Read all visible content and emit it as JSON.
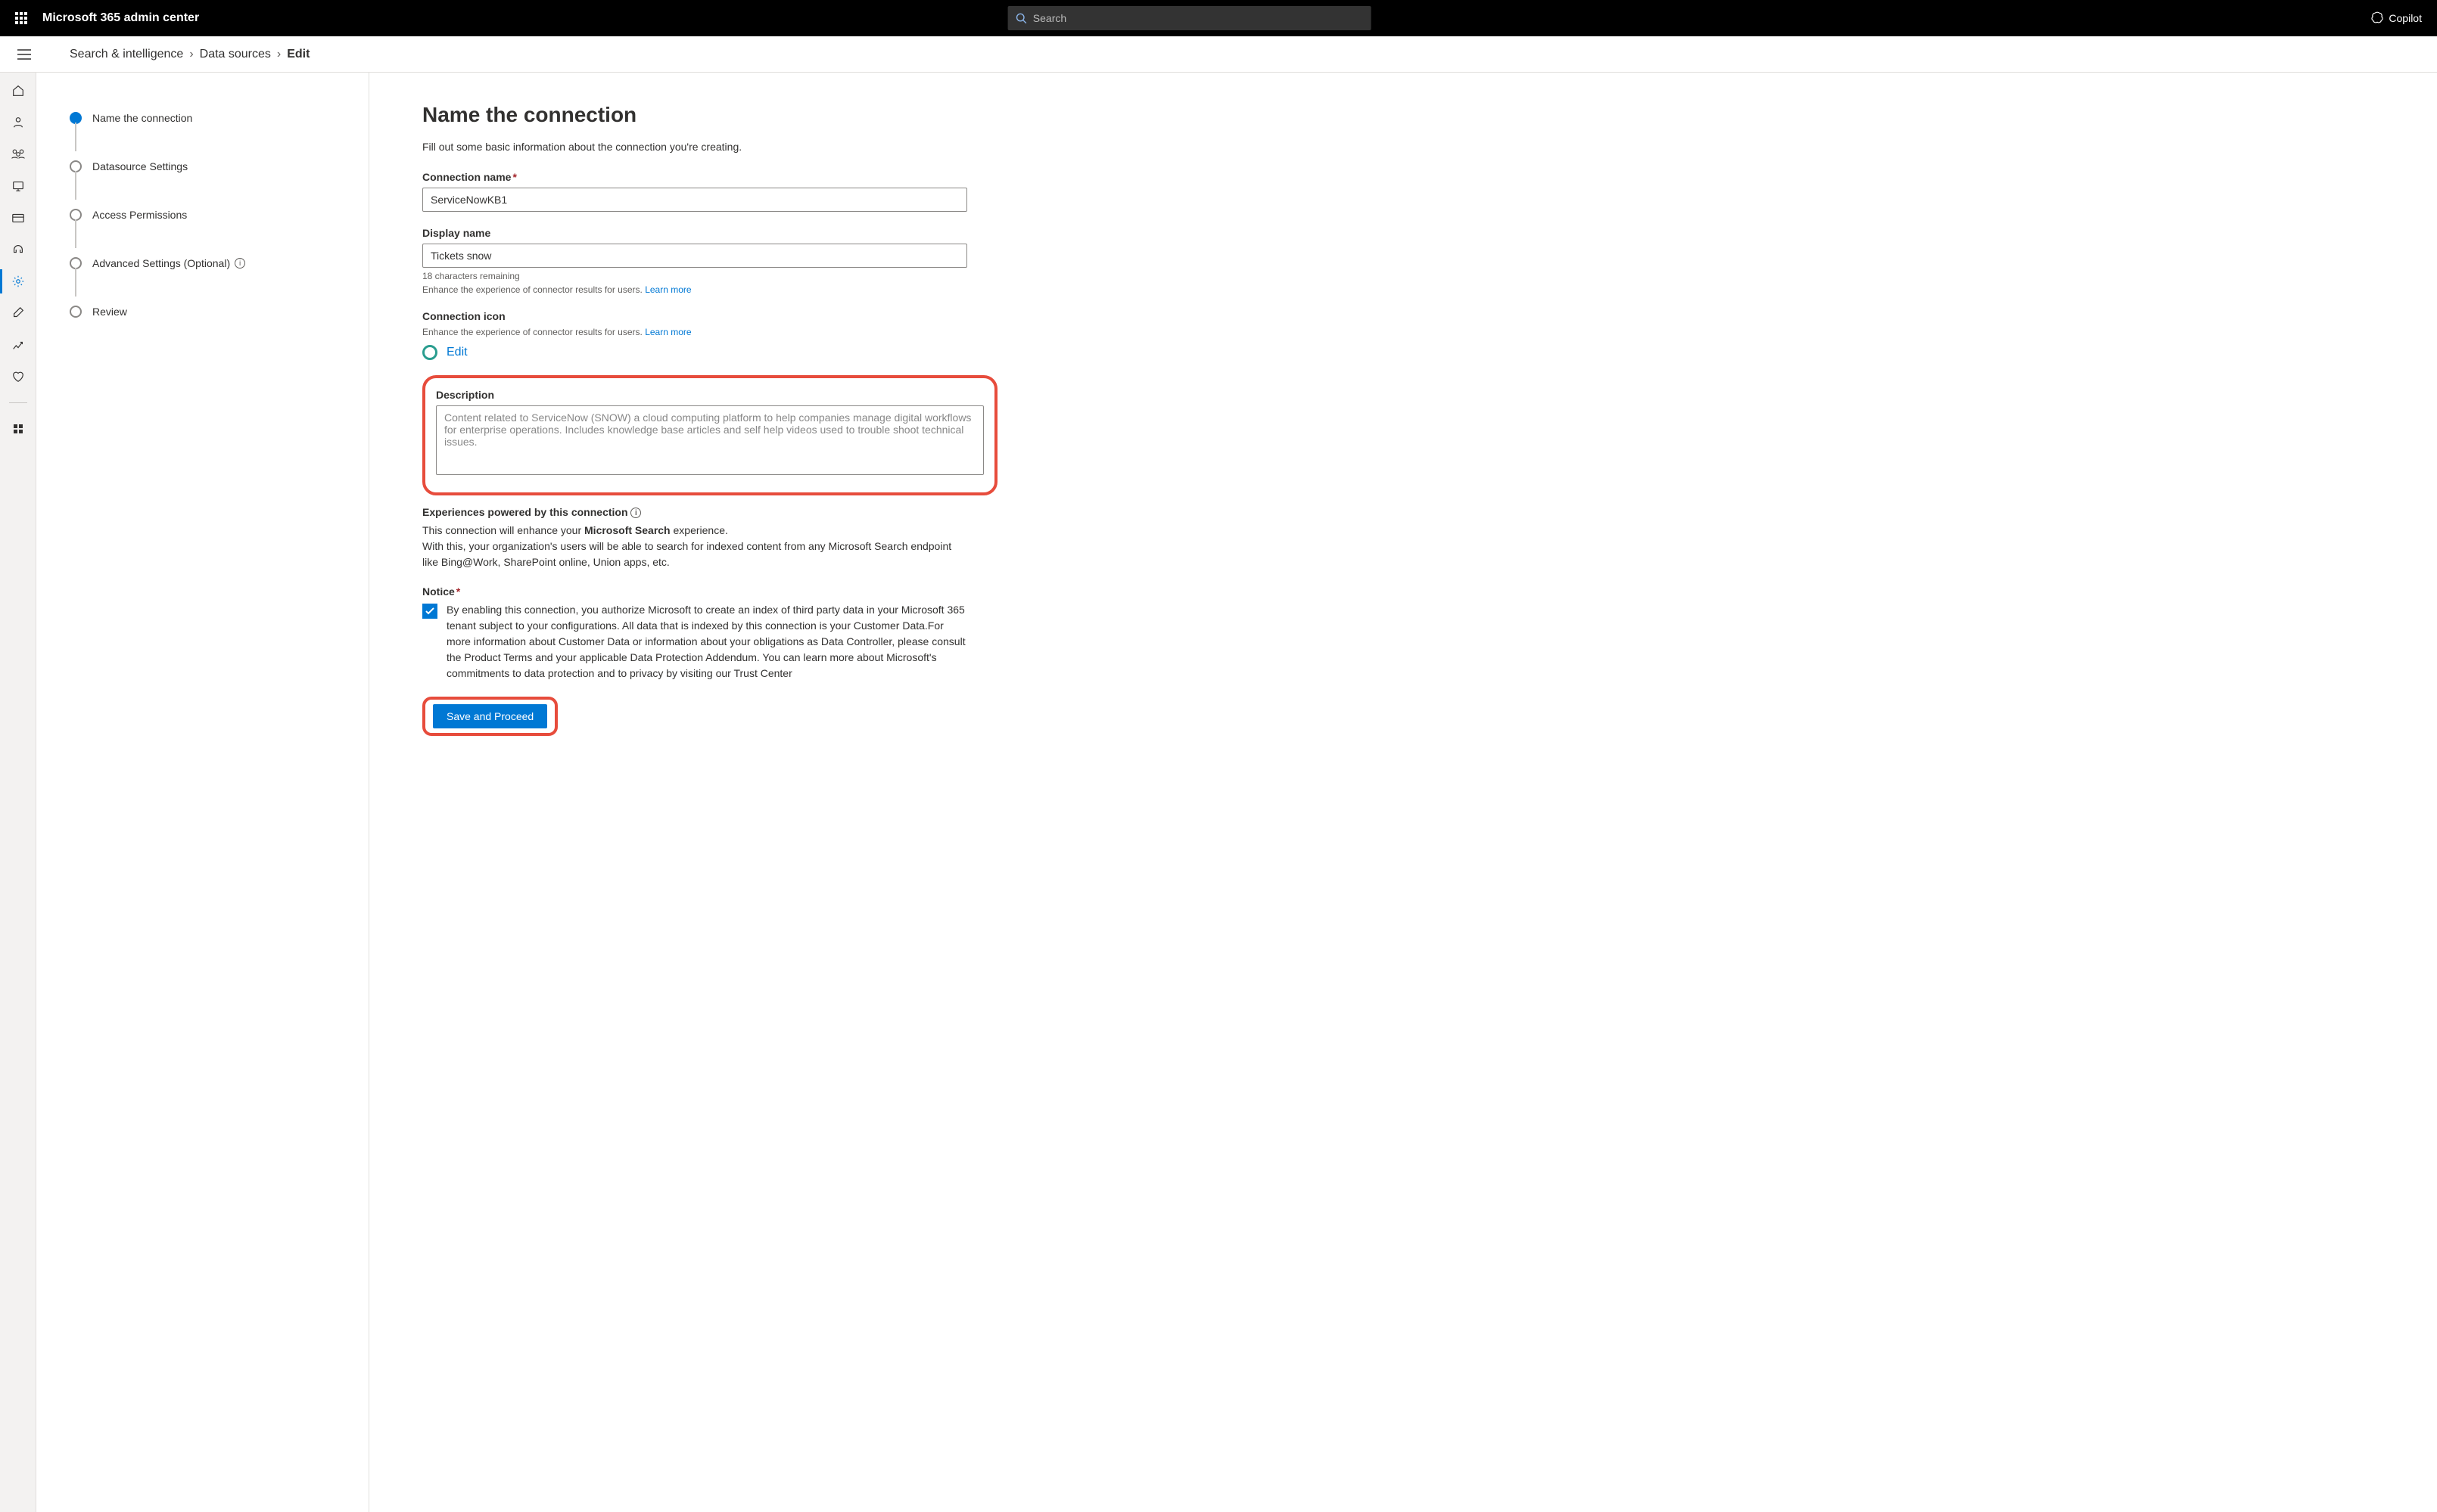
{
  "header": {
    "app_title": "Microsoft 365 admin center",
    "search_placeholder": "Search",
    "copilot_label": "Copilot"
  },
  "breadcrumb": {
    "level1": "Search & intelligence",
    "level2": "Data sources",
    "level3": "Edit"
  },
  "wizard": {
    "steps": [
      {
        "label": "Name the connection",
        "current": true
      },
      {
        "label": "Datasource Settings"
      },
      {
        "label": "Access Permissions"
      },
      {
        "label": "Advanced Settings (Optional)",
        "info": true
      },
      {
        "label": "Review"
      }
    ]
  },
  "page": {
    "title": "Name the connection",
    "intro": "Fill out some basic information about the connection you're creating.",
    "connection_name_label": "Connection name",
    "connection_name_value": "ServiceNowKB1",
    "display_name_label": "Display name",
    "display_name_value": "Tickets snow",
    "chars_remaining": "18 characters remaining",
    "enhance_text": "Enhance the experience of connector results for users.",
    "learn_more": "Learn more",
    "connection_icon_label": "Connection icon",
    "edit_link": "Edit",
    "description_label": "Description",
    "description_value": "Content related to ServiceNow (SNOW) a cloud computing platform to help companies manage digital workflows for enterprise operations. Includes knowledge base articles and self help videos used to trouble shoot technical issues.",
    "experiences_label": "Experiences powered by this connection",
    "experiences_line1a": "This connection will enhance your ",
    "experiences_line1b": "Microsoft Search",
    "experiences_line1c": " experience.",
    "experiences_line2": "With this, your organization's users will be able to search for indexed content from any Microsoft Search endpoint like Bing@Work, SharePoint online, Union apps, etc.",
    "notice_label": "Notice",
    "notice_text": "By enabling this connection, you authorize Microsoft to create an index of third party data in your Microsoft 365 tenant subject to your configurations. All data that is indexed by this connection is your Customer Data.For more information about Customer Data or information about your obligations as Data Controller, please consult the Product Terms and your applicable Data Protection Addendum. You can learn more about Microsoft's commitments to data protection and to privacy by visiting our Trust Center",
    "save_button": "Save and Proceed"
  }
}
